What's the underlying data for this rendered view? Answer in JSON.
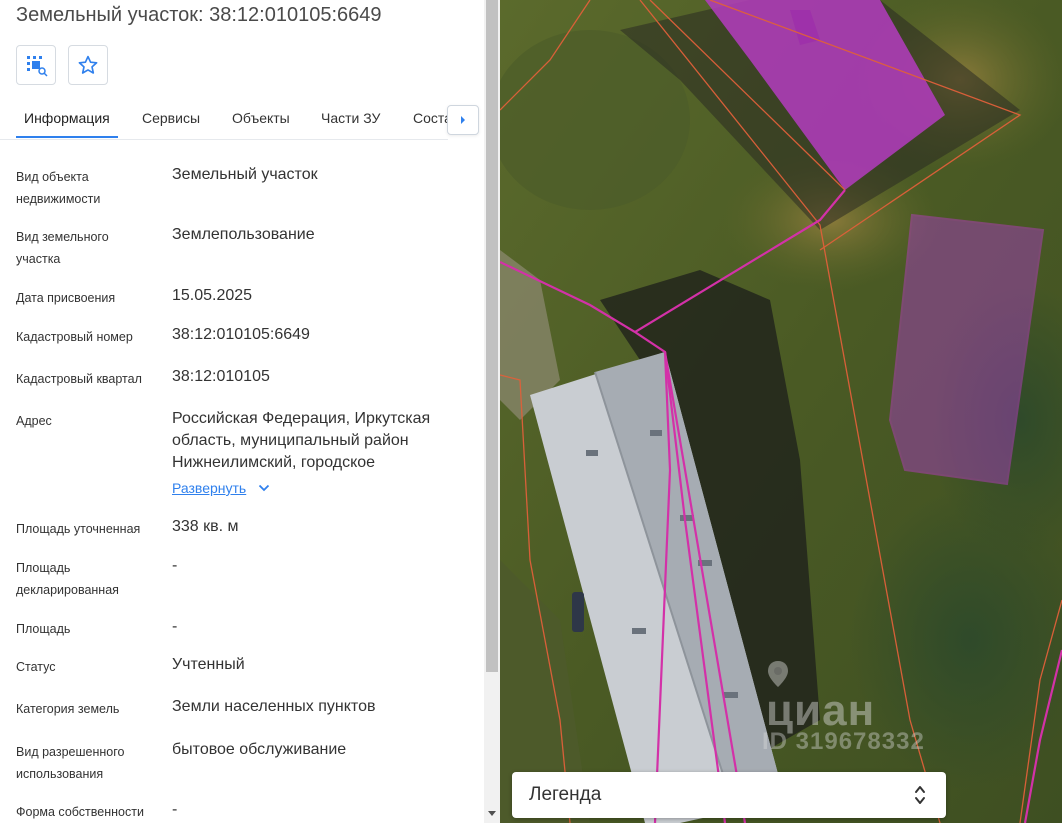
{
  "header": {
    "title": "Земельный участок: 38:12:010105:6649"
  },
  "toolbar": {
    "locate_icon": "locate-on-map-icon",
    "favorite_icon": "star-icon"
  },
  "tabs": [
    {
      "label": "Информация",
      "active": true
    },
    {
      "label": "Сервисы"
    },
    {
      "label": "Объекты"
    },
    {
      "label": "Части ЗУ"
    },
    {
      "label": "Соста"
    }
  ],
  "info": {
    "object_type": {
      "label": "Вид объекта недвижимости",
      "value": "Земельный участок"
    },
    "land_type": {
      "label": "Вид земельного участка",
      "value": "Землепользование"
    },
    "date_assigned": {
      "label": "Дата присвоения",
      "value": "15.05.2025"
    },
    "cadastral_number": {
      "label": "Кадастровый номер",
      "value": "38:12:010105:6649"
    },
    "cadastral_quarter": {
      "label": "Кадастровый квартал",
      "value": "38:12:010105"
    },
    "address": {
      "label": "Адрес",
      "value": "Российская Федерация, Иркутская область, муниципальный район Нижнеилимский, городское",
      "expand_label": "Развернуть"
    },
    "area_specified": {
      "label": "Площадь уточненная",
      "value": "338 кв. м"
    },
    "area_declared": {
      "label": "Площадь декларированная",
      "value": "-"
    },
    "area": {
      "label": "Площадь",
      "value": "-"
    },
    "status": {
      "label": "Статус",
      "value": "Учтенный"
    },
    "land_category": {
      "label": "Категория земель",
      "value": "Земли населенных пунктов"
    },
    "permitted_use": {
      "label": "Вид разрешенного использования",
      "value": "бытовое обслуживание"
    },
    "ownership": {
      "label": "Форма собственности",
      "value": "-"
    }
  },
  "map": {
    "watermark_brand": "циан",
    "watermark_id": "ID 319678332",
    "legend_label": "Легенда"
  },
  "colors": {
    "accent": "#2f80ed",
    "parcel_outline": "#e0356f",
    "building_fill": "#b43cc0"
  }
}
